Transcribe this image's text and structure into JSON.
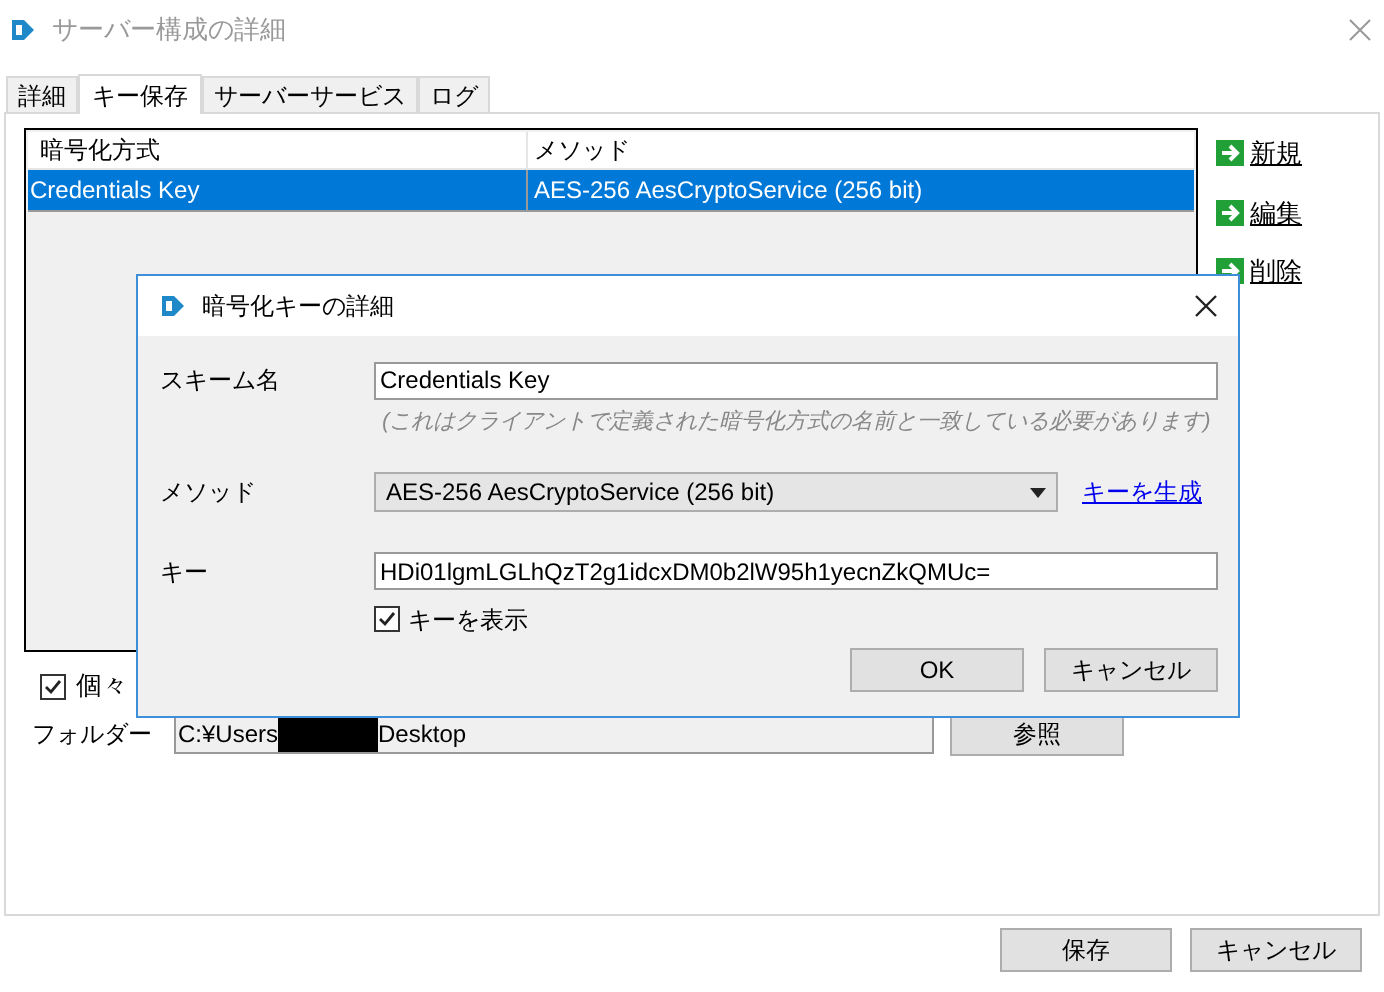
{
  "window": {
    "title": "サーバー構成の詳細"
  },
  "tabs": [
    {
      "label": "詳細",
      "selected": false
    },
    {
      "label": "キー保存",
      "selected": true
    },
    {
      "label": "サーバーサービス",
      "selected": false
    },
    {
      "label": "ログ",
      "selected": false
    }
  ],
  "table": {
    "columns": [
      "暗号化方式",
      "メソッド"
    ],
    "rows": [
      {
        "cells": [
          "Credentials Key",
          "AES-256 AesCryptoService (256 bit)"
        ],
        "selected": true
      }
    ]
  },
  "actions": [
    "新規",
    "編集",
    "削除"
  ],
  "option": {
    "label": "個々",
    "checked": true
  },
  "folder": {
    "label": "フォルダー",
    "value_start": "C:¥Users",
    "redacted": true,
    "value_end": "Desktop",
    "browse": "参照"
  },
  "buttons": [
    "保存",
    "キャンセル"
  ],
  "dialog": {
    "title": "暗号化キーの詳細",
    "scheme": {
      "label": "スキーム名",
      "value": "Credentials Key",
      "hint": "(これはクライアントで定義された暗号化方式の名前と一致している必要があります)"
    },
    "method": {
      "label": "メソッド",
      "value": "AES-256 AesCryptoService (256 bit)",
      "link": "キーを生成"
    },
    "key": {
      "label": "キー",
      "value": "HDi01lgmLGLhQzT2g1idcxDM0b2lW95h1yecnZkQMUc="
    },
    "show_key": {
      "label": "キーを表示",
      "checked": true
    },
    "buttons": [
      "OK",
      "キャンセル"
    ]
  }
}
